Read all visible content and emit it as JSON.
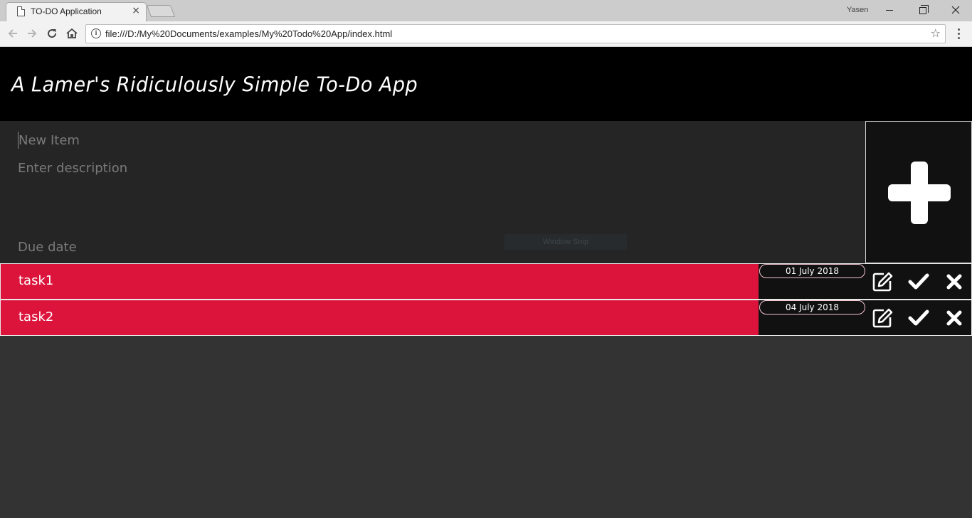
{
  "browser": {
    "tab_title": "TO-DO Application",
    "tab_close": "×",
    "profile_name": "Yasen",
    "url": "file:///D:/My%20Documents/examples/My%20Todo%20App/index.html"
  },
  "app": {
    "title": "A Lamer's Ridiculously Simple To-Do App",
    "form": {
      "title_placeholder": "New Item",
      "description_placeholder": "Enter description",
      "due_date_placeholder": "Due date",
      "overlay_text": "Window Snip"
    },
    "tasks": [
      {
        "name": "task1",
        "due_date": "01 July 2018"
      },
      {
        "name": "task2",
        "due_date": "04 July 2018"
      }
    ]
  },
  "colors": {
    "header_bg": "#000000",
    "form_bg": "#252525",
    "page_bg": "#333333",
    "task_bg": "#dc143c",
    "action_bg": "#111111"
  },
  "icons": {
    "add": "plus-icon",
    "edit": "edit-icon",
    "done": "check-icon",
    "delete": "close-icon"
  }
}
